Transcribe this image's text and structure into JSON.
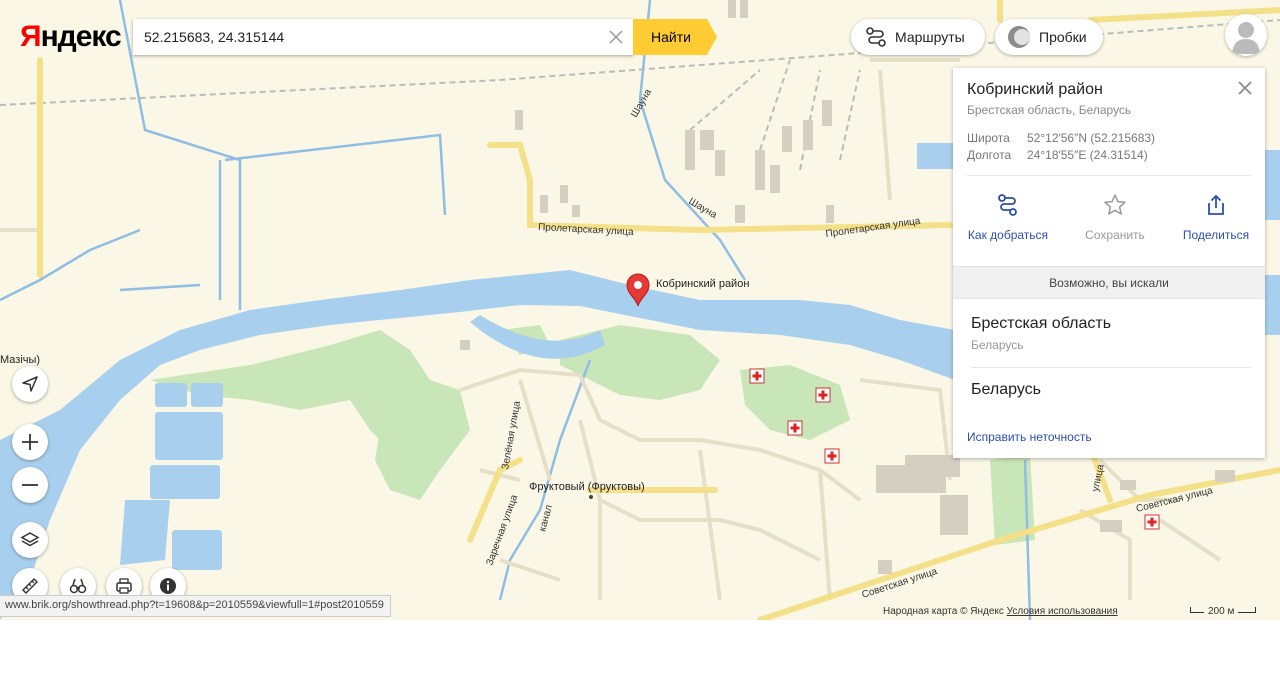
{
  "brand": {
    "logo_first": "Я",
    "logo_rest": "ндекс"
  },
  "search": {
    "value": "52.215683, 24.315144",
    "button": "Найти"
  },
  "topbar": {
    "routes": "Маршруты",
    "traffic": "Пробки"
  },
  "map": {
    "place_marker": "Кобринский район",
    "labels": {
      "proletarskaya_1": "Пролетарская улица",
      "proletarskaya_2": "Пролетарская улица",
      "shuyna_1": "Шауна",
      "shuyna_2": "Шауна",
      "zelenaya": "Зелёная улица",
      "zarechnaya": "Заречная улица",
      "kanal": "канал",
      "fruktovy": "Фруктовый (Фруктовы)",
      "sovetskaya_1": "Советская улица",
      "sovetskaya_2": "Советская улица",
      "mazichy": "Мазічы)",
      "road_right": "улица"
    }
  },
  "card": {
    "title": "Кобринский район",
    "subtitle": "Брестская область, Беларусь",
    "lat_label": "Широта",
    "lat_value": "52°12′56″N (52.215683)",
    "lon_label": "Долгота",
    "lon_value": "24°18′55″E (24.31514)",
    "action_route": "Как добраться",
    "action_save": "Сохранить",
    "action_share": "Поделиться",
    "maybe_header": "Возможно, вы искали",
    "suggestion1_name": "Брестская область",
    "suggestion1_sub": "Беларусь",
    "suggestion2_name": "Беларусь",
    "fix_link": "Исправить неточность"
  },
  "footer": {
    "url": "www.brik.org/showthread.php?t=19608&p=2010559&viewfull=1#post2010559",
    "copyright": "Народная карта © Яндекс",
    "terms": "Условия использования",
    "scale": "200 м"
  },
  "colors": {
    "land": "#fbf7e6",
    "water": "#a8d0ee",
    "green": "#c9e6b8",
    "road_major": "#fde79a",
    "accent_yellow": "#ffcc33",
    "link_blue": "#2b4fae",
    "marker_red": "#e53935"
  }
}
